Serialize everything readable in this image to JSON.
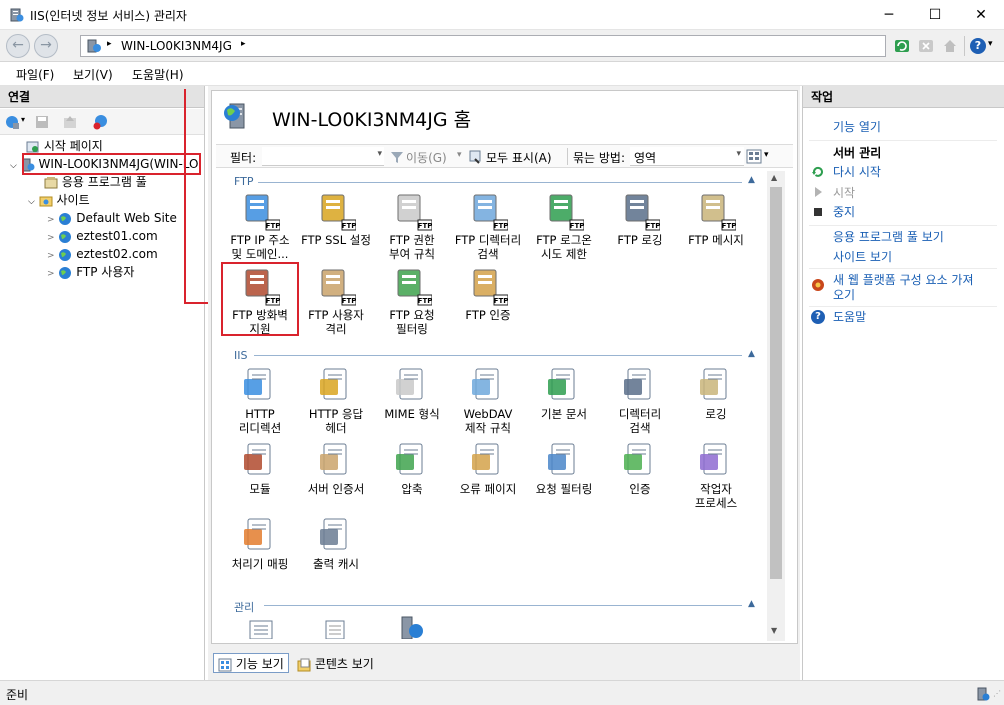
{
  "window": {
    "title": "IIS(인터넷 정보 서비스) 관리자",
    "minimize": "─",
    "maximize": "☐",
    "close": "✕"
  },
  "addressbar": {
    "crumb": "WIN-LO0KI3NM4JG",
    "sep1": "▸",
    "sep2": "▸",
    "back": "←",
    "forward": "→",
    "help": "?",
    "help_arrow": "▾"
  },
  "menu": {
    "file": "파일(F)",
    "view": "보기(V)",
    "help": "도움말(H)"
  },
  "connections": {
    "header": "연결",
    "tree": {
      "start_page": "시작 페이지",
      "server": "WIN-LO0KI3NM4JG(WIN-LO",
      "app_pools": "응용 프로그램 풀",
      "sites": "사이트",
      "site1": "Default Web Site",
      "site2": "eztest01.com",
      "site3": "eztest02.com",
      "site4": "FTP 사용자"
    }
  },
  "main": {
    "title": "WIN-LO0KI3NM4JG 홈",
    "filter_label": "필터:",
    "go_label": "이동(G)",
    "show_all": "모두 표시(A)",
    "group_label": "묶는 방법:",
    "group_value": "영역",
    "section_ftp": "FTP",
    "section_iis": "IIS",
    "section_mgmt": "관리",
    "ftp_features": [
      {
        "l1": "FTP IP 주소",
        "l2": "및 도메인..."
      },
      {
        "l1": "FTP SSL 설정",
        "l2": ""
      },
      {
        "l1": "FTP 권한",
        "l2": "부여 규칙"
      },
      {
        "l1": "FTP 디렉터리",
        "l2": "검색"
      },
      {
        "l1": "FTP 로그온",
        "l2": "시도 제한"
      },
      {
        "l1": "FTP 로깅",
        "l2": ""
      },
      {
        "l1": "FTP 메시지",
        "l2": ""
      },
      {
        "l1": "FTP 방화벽",
        "l2": "지원"
      },
      {
        "l1": "FTP 사용자",
        "l2": "격리"
      },
      {
        "l1": "FTP 요청",
        "l2": "필터링"
      },
      {
        "l1": "FTP 인증",
        "l2": ""
      }
    ],
    "iis_features": [
      {
        "l1": "HTTP",
        "l2": "리디렉션"
      },
      {
        "l1": "HTTP 응답",
        "l2": "헤더"
      },
      {
        "l1": "MIME 형식",
        "l2": ""
      },
      {
        "l1": "WebDAV",
        "l2": "제작 규칙"
      },
      {
        "l1": "기본 문서",
        "l2": ""
      },
      {
        "l1": "디렉터리",
        "l2": "검색"
      },
      {
        "l1": "로깅",
        "l2": ""
      },
      {
        "l1": "모듈",
        "l2": ""
      },
      {
        "l1": "서버 인증서",
        "l2": ""
      },
      {
        "l1": "압축",
        "l2": ""
      },
      {
        "l1": "오류 페이지",
        "l2": ""
      },
      {
        "l1": "요청 필터링",
        "l2": ""
      },
      {
        "l1": "인증",
        "l2": ""
      },
      {
        "l1": "작업자",
        "l2": "프로세스"
      },
      {
        "l1": "처리기 매핑",
        "l2": ""
      },
      {
        "l1": "출력 캐시",
        "l2": ""
      }
    ],
    "tab_features": "기능 보기",
    "tab_content": "콘텐츠 보기"
  },
  "actions": {
    "header": "작업",
    "open_feature": "기능 열기",
    "server_mgmt": "서버 관리",
    "restart": "다시 시작",
    "start": "시작",
    "stop": "중지",
    "view_app_pools": "응용 프로그램 풀 보기",
    "view_sites": "사이트 보기",
    "get_new_l1": "새 웹 플랫폼 구성 요소 가져",
    "get_new_l2": "오기",
    "help": "도움말"
  },
  "status": {
    "text": "준비"
  },
  "colors": {
    "highlight": "#d9232d",
    "link": "#1a5fb4",
    "section": "#3d6a9b"
  }
}
